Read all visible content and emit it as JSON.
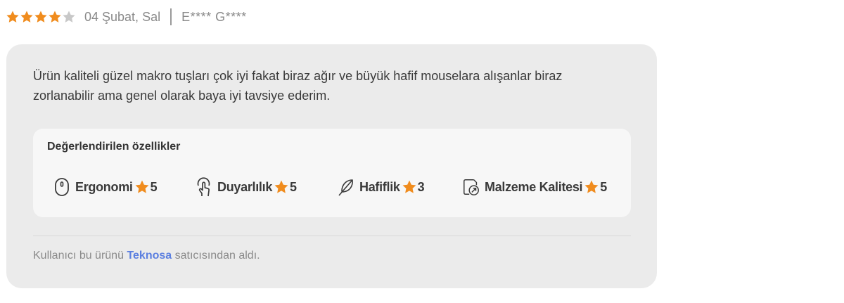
{
  "review": {
    "rating": 4,
    "rating_max": 5,
    "date": "04 Şubat, Sal",
    "author": "E**** G****",
    "comment_line1": "Ürün kaliteli güzel makro tuşları çok iyi fakat biraz ağır ve büyük hafif mouselara alışanlar biraz",
    "comment_line2": "zorlanabilir ama genel olarak baya iyi tavsiye ederim.",
    "features_title": "Değerlendirilen özellikler",
    "features": [
      {
        "name": "Ergonomi",
        "score": "5",
        "icon": "mouse-icon"
      },
      {
        "name": "Duyarlılık",
        "score": "5",
        "icon": "touch-hand-icon"
      },
      {
        "name": "Hafiflik",
        "score": "3",
        "icon": "feather-icon"
      },
      {
        "name": "Malzeme Kalitesi",
        "score": "5",
        "icon": "material-quality-icon"
      }
    ],
    "seller_prefix": "Kullanıcı bu ürünü",
    "seller_name": "Teknosa",
    "seller_suffix": "satıcısından aldı."
  },
  "colors": {
    "star_filled": "#f08c1e",
    "star_empty": "#c8c8c8",
    "card_bg": "#ebebeb",
    "inner_bg": "#f7f7f7",
    "link": "#5b7fe0"
  }
}
